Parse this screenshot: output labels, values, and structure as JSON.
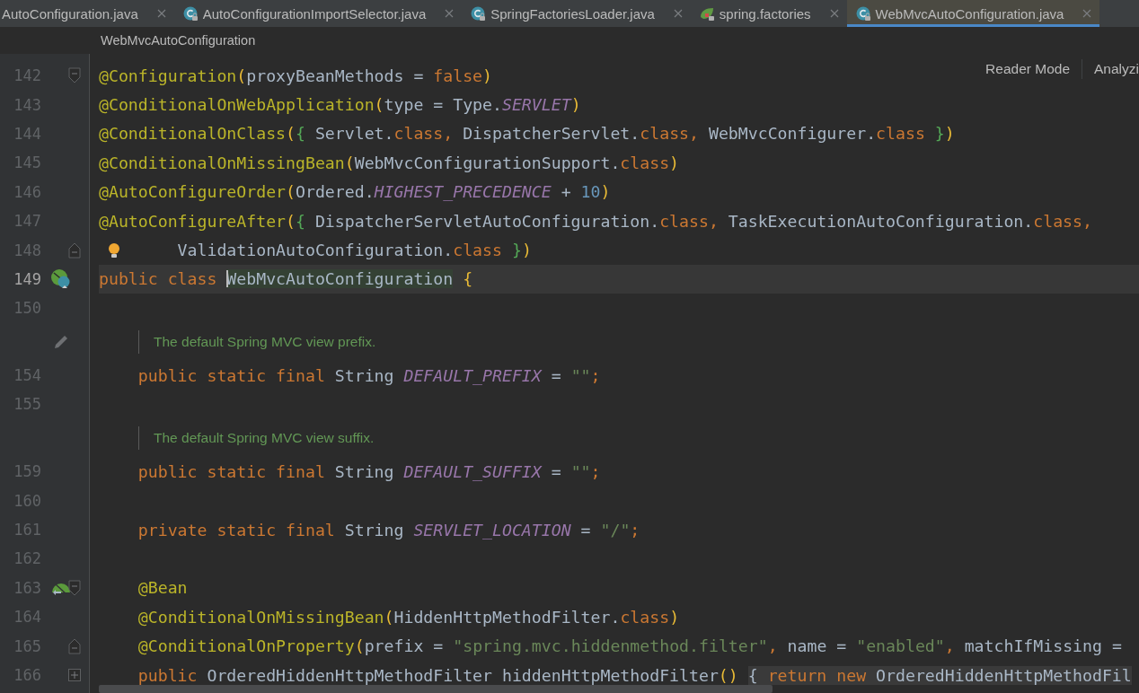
{
  "tabs": [
    {
      "label": "AutoConfiguration.java",
      "kind": "plain-file",
      "selected": false
    },
    {
      "label": "AutoConfigurationImportSelector.java",
      "kind": "class-file",
      "selected": false
    },
    {
      "label": "SpringFactoriesLoader.java",
      "kind": "class-file",
      "selected": false
    },
    {
      "label": "spring.factories",
      "kind": "spring-file",
      "selected": false
    },
    {
      "label": "WebMvcAutoConfiguration.java",
      "kind": "class-file",
      "selected": true
    }
  ],
  "breadcrumb": "WebMvcAutoConfiguration",
  "editor_actions": [
    "Reader Mode",
    "Analyzi"
  ],
  "lines": [
    {
      "kind": "code",
      "number": "142",
      "current": false,
      "gutter_marks": [
        {
          "kind": "fold-start"
        }
      ],
      "tokens": [
        {
          "kind": "annotation",
          "text": "@Configuration"
        },
        {
          "kind": "paren",
          "text": "("
        },
        {
          "kind": "plain",
          "text": "proxyBeanMethods = "
        },
        {
          "kind": "keyword",
          "text": "false"
        },
        {
          "kind": "paren",
          "text": ")"
        }
      ]
    },
    {
      "kind": "code",
      "number": "143",
      "current": false,
      "tokens": [
        {
          "kind": "annotation",
          "text": "@ConditionalOnWebApplication"
        },
        {
          "kind": "paren",
          "text": "("
        },
        {
          "kind": "plain",
          "text": "type = Type."
        },
        {
          "kind": "constant",
          "text": "SERVLET"
        },
        {
          "kind": "paren",
          "text": ")"
        }
      ]
    },
    {
      "kind": "code",
      "number": "144",
      "current": false,
      "tokens": [
        {
          "kind": "annotation",
          "text": "@ConditionalOnClass"
        },
        {
          "kind": "paren",
          "text": "("
        },
        {
          "kind": "brace",
          "text": "{"
        },
        {
          "kind": "plain",
          "text": " Servlet."
        },
        {
          "kind": "keyword",
          "text": "class, "
        },
        {
          "kind": "plain",
          "text": "DispatcherServlet."
        },
        {
          "kind": "keyword",
          "text": "class, "
        },
        {
          "kind": "plain",
          "text": "WebMvcConfigurer."
        },
        {
          "kind": "keyword",
          "text": "class "
        },
        {
          "kind": "brace",
          "text": "}"
        },
        {
          "kind": "paren",
          "text": ")"
        }
      ]
    },
    {
      "kind": "code",
      "number": "145",
      "current": false,
      "tokens": [
        {
          "kind": "annotation",
          "text": "@ConditionalOnMissingBean"
        },
        {
          "kind": "paren",
          "text": "("
        },
        {
          "kind": "plain",
          "text": "WebMvcConfigurationSupport."
        },
        {
          "kind": "keyword",
          "text": "class"
        },
        {
          "kind": "paren",
          "text": ")"
        }
      ]
    },
    {
      "kind": "code",
      "number": "146",
      "current": false,
      "tokens": [
        {
          "kind": "annotation",
          "text": "@AutoConfigureOrder"
        },
        {
          "kind": "paren",
          "text": "("
        },
        {
          "kind": "plain",
          "text": "Ordered."
        },
        {
          "kind": "constant",
          "text": "HIGHEST_PRECEDENCE"
        },
        {
          "kind": "plain",
          "text": " + "
        },
        {
          "kind": "number",
          "text": "10"
        },
        {
          "kind": "paren",
          "text": ")"
        }
      ]
    },
    {
      "kind": "code",
      "number": "147",
      "current": false,
      "tokens": [
        {
          "kind": "annotation",
          "text": "@AutoConfigureAfter"
        },
        {
          "kind": "paren",
          "text": "("
        },
        {
          "kind": "brace",
          "text": "{"
        },
        {
          "kind": "plain",
          "text": " DispatcherServletAutoConfiguration."
        },
        {
          "kind": "keyword",
          "text": "class, "
        },
        {
          "kind": "plain",
          "text": "TaskExecutionAutoConfiguration."
        },
        {
          "kind": "keyword",
          "text": "class,"
        }
      ]
    },
    {
      "kind": "code",
      "number": "148",
      "current": false,
      "gutter_marks": [
        {
          "kind": "fold-end"
        }
      ],
      "intention": true,
      "tokens": [
        {
          "kind": "plain",
          "text": "        ValidationAutoConfiguration."
        },
        {
          "kind": "keyword",
          "text": "class "
        },
        {
          "kind": "brace",
          "text": "}"
        },
        {
          "kind": "paren",
          "text": ")"
        }
      ]
    },
    {
      "kind": "code",
      "number": "149",
      "current": true,
      "gutter_marks": [
        {
          "kind": "bean-class"
        }
      ],
      "tokens": [
        {
          "kind": "keyword",
          "text": "public class "
        },
        {
          "kind": "usage",
          "text": "WebMvcAutoConfiguration",
          "caret": true
        },
        {
          "kind": "paren",
          "text": " {"
        }
      ]
    },
    {
      "kind": "code",
      "number": "150",
      "current": false
    },
    {
      "kind": "doc",
      "text": "The default Spring MVC view prefix.",
      "gutter_marks": [
        {
          "kind": "pencil"
        }
      ]
    },
    {
      "kind": "code",
      "number": "154",
      "current": false,
      "tokens": [
        {
          "kind": "keyword",
          "text": "    public static final "
        },
        {
          "kind": "plain",
          "text": "String "
        },
        {
          "kind": "constant",
          "text": "DEFAULT_PREFIX"
        },
        {
          "kind": "plain",
          "text": " = "
        },
        {
          "kind": "string",
          "text": "\"\""
        },
        {
          "kind": "keyword",
          "text": ";"
        }
      ]
    },
    {
      "kind": "code",
      "number": "155",
      "current": false
    },
    {
      "kind": "doc",
      "text": "The default Spring MVC view suffix."
    },
    {
      "kind": "code",
      "number": "159",
      "current": false,
      "tokens": [
        {
          "kind": "keyword",
          "text": "    public static final "
        },
        {
          "kind": "plain",
          "text": "String "
        },
        {
          "kind": "constant",
          "text": "DEFAULT_SUFFIX"
        },
        {
          "kind": "plain",
          "text": " = "
        },
        {
          "kind": "string",
          "text": "\"\""
        },
        {
          "kind": "keyword",
          "text": ";"
        }
      ]
    },
    {
      "kind": "code",
      "number": "160",
      "current": false
    },
    {
      "kind": "code",
      "number": "161",
      "current": false,
      "tokens": [
        {
          "kind": "keyword",
          "text": "    private static final "
        },
        {
          "kind": "plain",
          "text": "String "
        },
        {
          "kind": "constant",
          "text": "SERVLET_LOCATION"
        },
        {
          "kind": "plain",
          "text": " = "
        },
        {
          "kind": "string",
          "text": "\"/\""
        },
        {
          "kind": "keyword",
          "text": ";"
        }
      ]
    },
    {
      "kind": "code",
      "number": "162",
      "current": false
    },
    {
      "kind": "code",
      "number": "163",
      "current": false,
      "gutter_marks": [
        {
          "kind": "bean"
        },
        {
          "kind": "fold-start"
        }
      ],
      "tokens": [
        {
          "kind": "annotation",
          "text": "    @Bean"
        }
      ]
    },
    {
      "kind": "code",
      "number": "164",
      "current": false,
      "tokens": [
        {
          "kind": "annotation",
          "text": "    @ConditionalOnMissingBean"
        },
        {
          "kind": "paren",
          "text": "("
        },
        {
          "kind": "plain",
          "text": "HiddenHttpMethodFilter."
        },
        {
          "kind": "keyword",
          "text": "class"
        },
        {
          "kind": "paren",
          "text": ")"
        }
      ]
    },
    {
      "kind": "code",
      "number": "165",
      "current": false,
      "gutter_marks": [
        {
          "kind": "fold-end"
        }
      ],
      "tokens": [
        {
          "kind": "annotation",
          "text": "    @ConditionalOnProperty"
        },
        {
          "kind": "paren",
          "text": "("
        },
        {
          "kind": "plain",
          "text": "prefix = "
        },
        {
          "kind": "string",
          "text": "\"spring.mvc.hiddenmethod.filter\""
        },
        {
          "kind": "keyword",
          "text": ", "
        },
        {
          "kind": "plain",
          "text": "name = "
        },
        {
          "kind": "string",
          "text": "\"enabled\""
        },
        {
          "kind": "keyword",
          "text": ", "
        },
        {
          "kind": "plain",
          "text": "matchIfMissing ="
        }
      ]
    },
    {
      "kind": "code",
      "number": "166",
      "current": false,
      "gutter_marks": [
        {
          "kind": "fold-collapsed"
        }
      ],
      "tokens": [
        {
          "kind": "keyword",
          "text": "    public "
        },
        {
          "kind": "plain",
          "text": "OrderedHiddenHttpMethodFilter hiddenHttpMethodFilter"
        },
        {
          "kind": "paren",
          "text": "() "
        },
        {
          "kind": "folded",
          "text": "{ "
        },
        {
          "kind": "folded-keyword",
          "text": "return new "
        },
        {
          "kind": "folded",
          "text": "OrderedHiddenHttpMethodFil"
        }
      ]
    }
  ]
}
